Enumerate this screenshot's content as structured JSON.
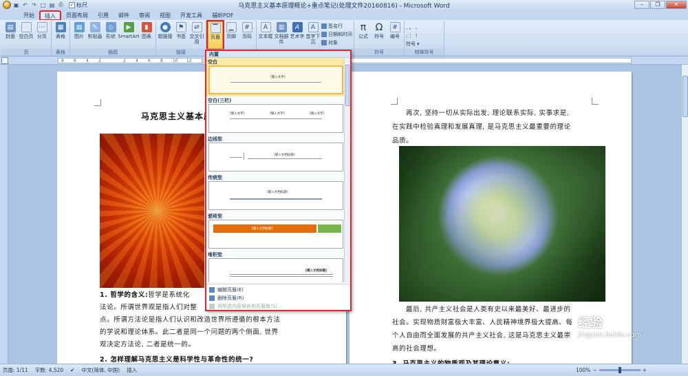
{
  "window": {
    "title": "马克思主义基本原理概论+重点笔记(处理文件20160816) - Microsoft Word",
    "qat_ruler_label": "标尺"
  },
  "tabs": [
    {
      "label": "开始"
    },
    {
      "label": "插入",
      "active": true
    },
    {
      "label": "页面布局"
    },
    {
      "label": "引用"
    },
    {
      "label": "邮件"
    },
    {
      "label": "审阅"
    },
    {
      "label": "视图"
    },
    {
      "label": "开发工具"
    },
    {
      "label": "福昕PDF"
    }
  ],
  "ribbon": {
    "groups": [
      {
        "name": "页",
        "buttons": [
          "封面",
          "空白页",
          "分页"
        ]
      },
      {
        "name": "表格",
        "buttons": [
          "表格"
        ]
      },
      {
        "name": "插图",
        "buttons": [
          "图片",
          "剪贴画",
          "形状",
          "SmartArt",
          "图表"
        ]
      },
      {
        "name": "链接",
        "buttons": [
          "超链接",
          "书签",
          "交叉引用"
        ]
      },
      {
        "name": "",
        "buttons": [
          "页眉",
          "页脚",
          "页码"
        ]
      },
      {
        "name": "",
        "buttons": [
          "文本框",
          "文档部件",
          "艺术字",
          "首字下沉"
        ],
        "small": [
          "签名行",
          "日期和时间",
          "对象"
        ]
      },
      {
        "name": "符号",
        "buttons": [
          "公式",
          "符号",
          "编号"
        ]
      },
      {
        "name": "特殊符号",
        "buttons": [
          "符号"
        ]
      }
    ]
  },
  "ruler": {
    "ticks": [
      "8",
      "6",
      "4",
      "2",
      "2",
      "4",
      "6",
      "8",
      "10",
      "12"
    ]
  },
  "document": {
    "page1": {
      "heading": "马克思主义基本原",
      "lines": [
        {
          "bold": "1. 哲学的含义:",
          "text": "哲学是系统化"
        },
        {
          "text": "法论。所谓世界观是指人们对整"
        },
        {
          "text": "点。所谓方法论是指人们认识和改造世界所遵循的根本方法"
        },
        {
          "text": "的学说和理论体系。此二者是同一个问题的两个侧面, 世界"
        },
        {
          "text": "观决定方法论, 二者是统一的。"
        },
        {
          "bold": "2. 怎样理解马克思主义是科学性与革命性的统一?"
        }
      ]
    },
    "page2": {
      "top_lines": [
        "再次, 坚持一切从实际出发, 理论联系实际, 实事求是,",
        "在实践中检验真理和发展真理, 是马克思主义最重要的理论",
        "品质。"
      ],
      "bottom_lines": [
        "最后, 共产主义社会是人类有史以来最美好、最进步的",
        "社会。实现物质财富极大丰富、人民精神境界极大提高、每",
        "个人自由而全面发展的共产主义社会, 这是马克思主义最崇",
        "高的社会理想。"
      ],
      "last_heading": "3. 马克思主义的物质观及其理论意义:"
    }
  },
  "dropdown": {
    "header": "内置",
    "items": [
      {
        "title": "空白",
        "preview": "[键入文字]",
        "selected": true
      },
      {
        "title": "空白(三栏)",
        "preview": "[键入文字]"
      },
      {
        "title": "边线型",
        "preview": "[键入文档标题]"
      },
      {
        "title": "传统型",
        "preview": "[键入文档标题]"
      },
      {
        "title": "瓷砖型",
        "preview": "[键入文档标题]"
      },
      {
        "title": "堆积型",
        "preview": "[键入文档标题]"
      }
    ],
    "menu": [
      {
        "label": "编辑页眉(E)"
      },
      {
        "label": "删除页眉(R)"
      },
      {
        "label": "将所选内容保存到页眉库(S)...",
        "disabled": true
      }
    ],
    "accent_orange": "#e46c0a",
    "accent_green": "#77b64b"
  },
  "status": {
    "page": "页面: 1/11",
    "words": "字数: 4,520",
    "lang": "中文(简体, 中国)",
    "mode": "插入",
    "zoom": "100%"
  },
  "watermark": {
    "brand": "经验",
    "url": "jingyan.baidu.com"
  }
}
